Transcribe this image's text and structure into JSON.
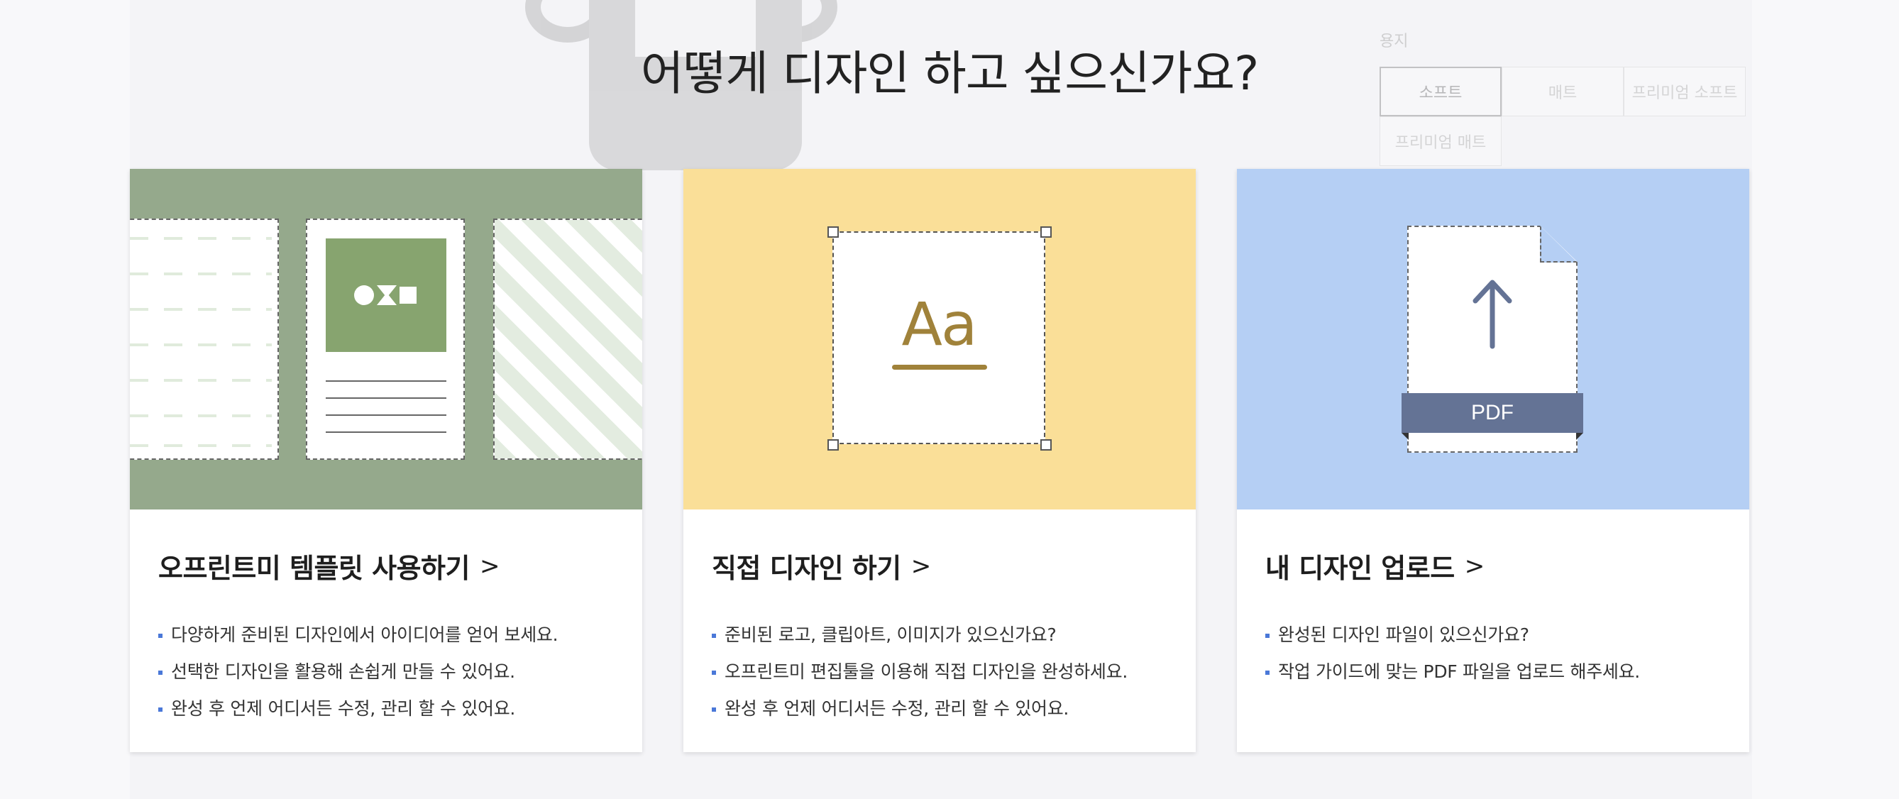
{
  "background": {
    "option_label": "용지",
    "options": [
      "소프트",
      "매트",
      "프리미엄 소프트",
      "프리미엄 매트"
    ],
    "selected_option": "소프트"
  },
  "headline": "어떻게 디자인 하고 싶으신가요?",
  "cards": [
    {
      "title": "오프린트미 템플릿 사용하기",
      "accent": "#95a98c",
      "bullets": [
        "다양하게 준비된 디자인에서 아이디어를 얻어 보세요.",
        "선택한 디자인을 활용해 손쉽게 만들 수 있어요.",
        "완성 후 언제 어디서든 수정, 관리 할 수 있어요."
      ]
    },
    {
      "title": "직접 디자인 하기",
      "accent": "#fadf98",
      "art_text": "Aa",
      "bullets": [
        "준비된 로고, 클립아트, 이미지가 있으신가요?",
        "오프린트미 편집툴을 이용해 직접 디자인을 완성하세요.",
        "완성 후 언제 어디서든 수정, 관리 할 수 있어요."
      ]
    },
    {
      "title": "내 디자인 업로드",
      "accent": "#b5cff4",
      "art_text": "PDF",
      "bullets": [
        "완성된 디자인 파일이 있으신가요?",
        "작업 가이드에 맞는 PDF 파일을 업로드 해주세요."
      ]
    }
  ],
  "chevron": ">",
  "icons": [
    "shapes-icon",
    "text-icon",
    "upload-arrow-icon",
    "chevron-right-icon"
  ]
}
